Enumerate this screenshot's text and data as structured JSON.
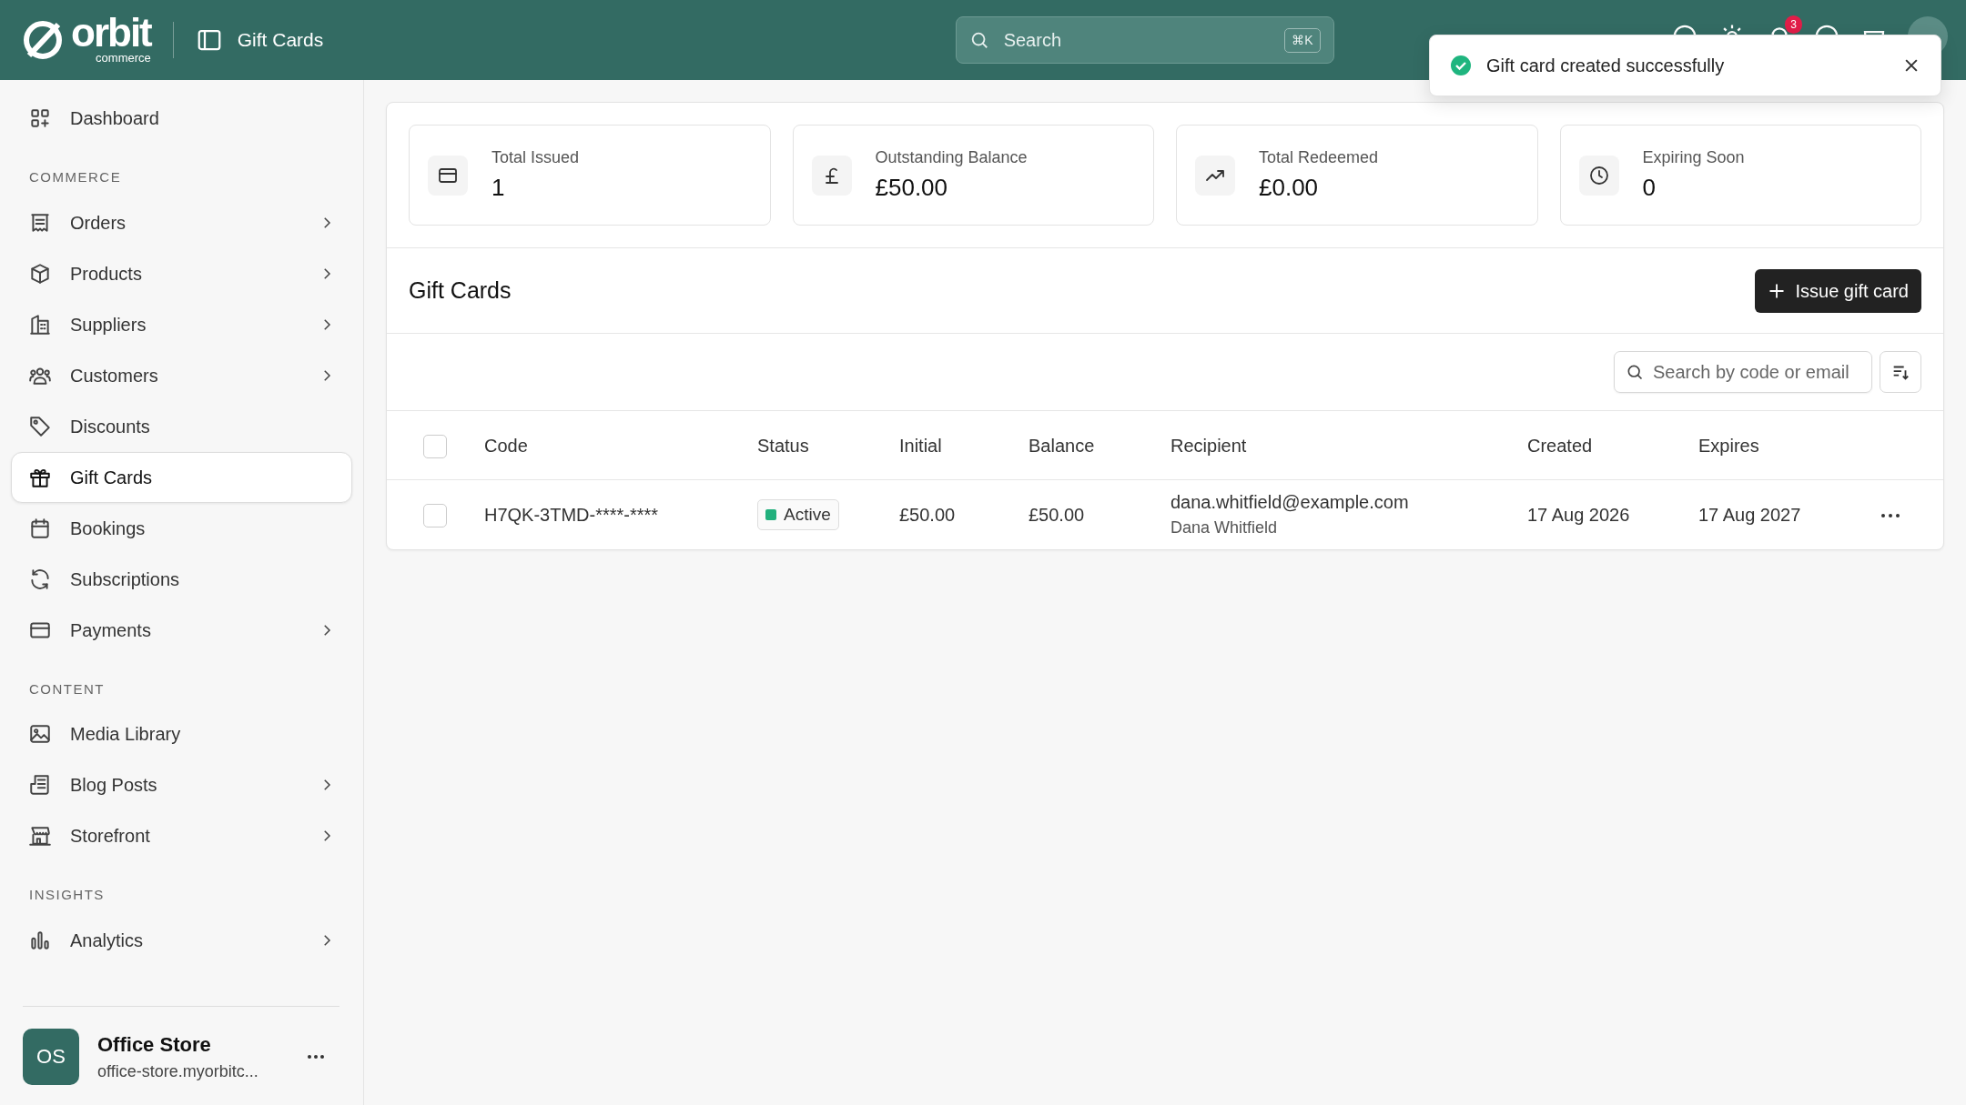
{
  "header": {
    "logo_text": "orbit",
    "logo_sub": "commerce",
    "page_title": "Gift Cards",
    "search": {
      "placeholder": "Search",
      "shortcut": "⌘K"
    },
    "notification_count": "3"
  },
  "toast": {
    "message": "Gift card created successfully"
  },
  "sidebar": {
    "sections": [
      {
        "items": [
          {
            "label": "Dashboard",
            "expandable": false,
            "selected": false
          }
        ]
      },
      {
        "heading": "COMMERCE",
        "items": [
          {
            "label": "Orders",
            "expandable": true,
            "selected": false
          },
          {
            "label": "Products",
            "expandable": true,
            "selected": false
          },
          {
            "label": "Suppliers",
            "expandable": true,
            "selected": false
          },
          {
            "label": "Customers",
            "expandable": true,
            "selected": false
          },
          {
            "label": "Discounts",
            "expandable": false,
            "selected": false
          },
          {
            "label": "Gift Cards",
            "expandable": false,
            "selected": true
          },
          {
            "label": "Bookings",
            "expandable": false,
            "selected": false
          },
          {
            "label": "Subscriptions",
            "expandable": false,
            "selected": false
          },
          {
            "label": "Payments",
            "expandable": true,
            "selected": false
          }
        ]
      },
      {
        "heading": "CONTENT",
        "items": [
          {
            "label": "Media Library",
            "expandable": false,
            "selected": false
          },
          {
            "label": "Blog Posts",
            "expandable": true,
            "selected": false
          },
          {
            "label": "Storefront",
            "expandable": true,
            "selected": false
          }
        ]
      },
      {
        "heading": "INSIGHTS",
        "items": [
          {
            "label": "Analytics",
            "expandable": true,
            "selected": false
          }
        ]
      }
    ],
    "store": {
      "initials": "OS",
      "name": "Office Store",
      "url": "office-store.myorbitc..."
    }
  },
  "stats": [
    {
      "label": "Total Issued",
      "value": "1"
    },
    {
      "label": "Outstanding Balance",
      "value": "£50.00"
    },
    {
      "label": "Total Redeemed",
      "value": "£0.00"
    },
    {
      "label": "Expiring Soon",
      "value": "0"
    }
  ],
  "panel": {
    "title": "Gift Cards",
    "issue_button": "Issue gift card",
    "filter": {
      "placeholder": "Search by code or email"
    },
    "table": {
      "select_all_checked": false,
      "columns": [
        "Code",
        "Status",
        "Initial",
        "Balance",
        "Recipient",
        "Created",
        "Expires"
      ],
      "rows": [
        {
          "checked": false,
          "code": "H7QK-3TMD-****-****",
          "status": {
            "label": "Active",
            "color": "#22b07d"
          },
          "initial": "£50.00",
          "balance": "£50.00",
          "recipient_email": "dana.whitfield@example.com",
          "recipient_name": "Dana Whitfield",
          "created": "17 Aug 2026",
          "expires": "17 Aug 2027"
        }
      ]
    }
  }
}
